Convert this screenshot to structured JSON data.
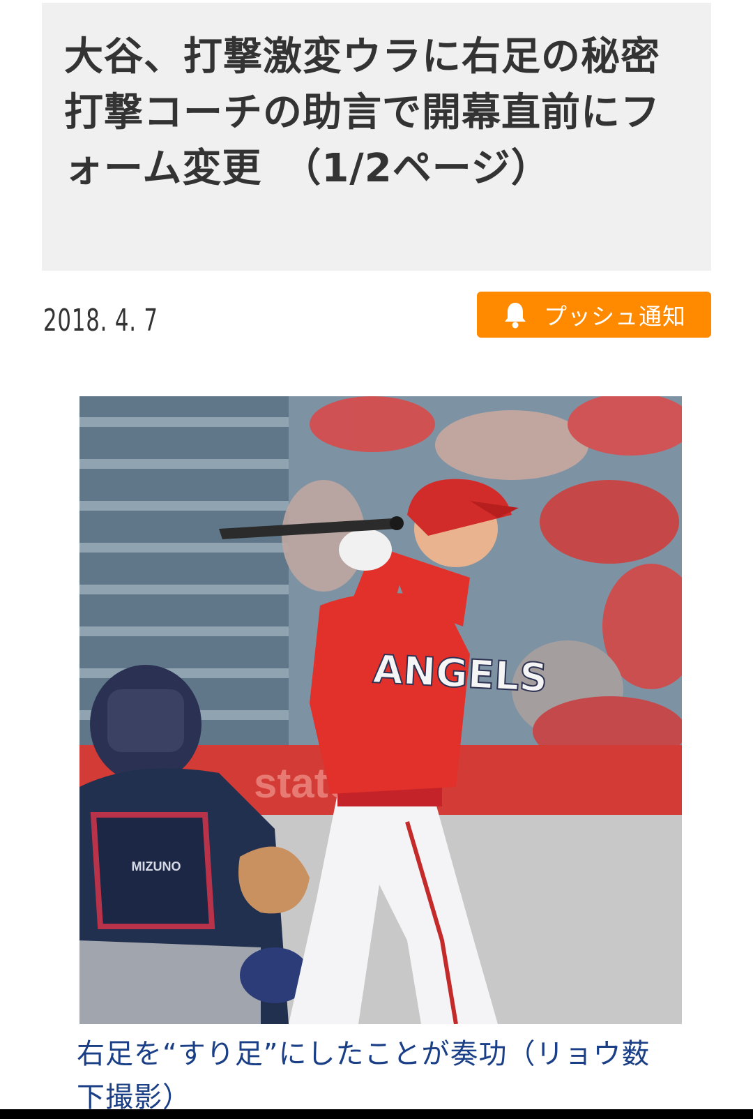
{
  "article": {
    "title": "大谷、打撃激変ウラに右足の秘密　打撃コーチの助言で開幕直前にフォーム変更　（1/2ページ）",
    "date": "2018. 4. 7"
  },
  "push_button": {
    "label": "プッシュ通知",
    "icon": "bell-icon",
    "color": "#ff8a00"
  },
  "photo": {
    "jersey_text": "ANGELS",
    "wall_text": "state",
    "gear_logo": "MIZUNO"
  },
  "caption": {
    "text": "右足を“すり足”にしたことが奏功（リョウ薮下撮影）",
    "color": "#1a3f86"
  }
}
